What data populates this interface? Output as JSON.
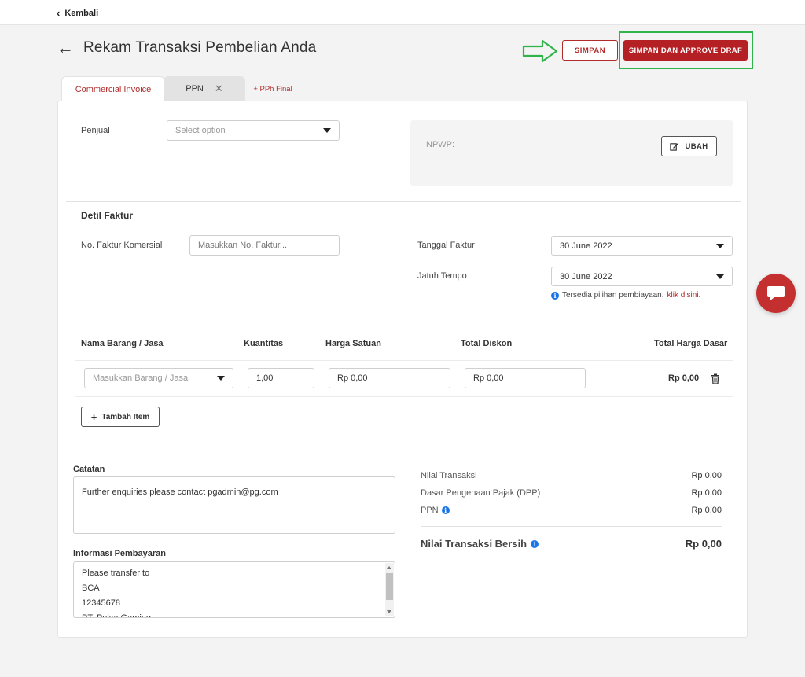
{
  "topbar": {
    "back_label": "Kembali"
  },
  "header": {
    "title": "Rekam Transaksi Pembelian Anda",
    "save_label": "SIMPAN",
    "save_approve_label": "SIMPAN DAN APPROVE DRAF"
  },
  "tabs": [
    {
      "label": "Commercial Invoice",
      "active": true
    },
    {
      "label": "PPN",
      "closable": true
    },
    {
      "label": "+ PPh Final"
    }
  ],
  "seller": {
    "label": "Penjual",
    "placeholder": "Select option",
    "npwp_label": "NPWP:",
    "edit_label": "UBAH"
  },
  "invoice_detail": {
    "section_title": "Detil Faktur",
    "invoice_no_label": "No. Faktur Komersial",
    "invoice_no_placeholder": "Masukkan No. Faktur...",
    "invoice_date_label": "Tanggal Faktur",
    "invoice_date_value": "30 June 2022",
    "due_label": "Jatuh Tempo",
    "due_value": "30 June 2022",
    "financing_note": "Tersedia pilihan pembiayaan,",
    "financing_link": "klik disini."
  },
  "items": {
    "columns": [
      "Nama Barang / Jasa",
      "Kuantitas",
      "Harga Satuan",
      "Total Diskon",
      "Total Harga Dasar"
    ],
    "rows": [
      {
        "item_placeholder": "Masukkan Barang / Jasa",
        "quantity": "1,00",
        "unit_price": "Rp 0,00",
        "discount": "Rp 0,00",
        "total": "Rp 0,00"
      }
    ],
    "add_label": "Tambah Item"
  },
  "notes": {
    "label": "Catatan",
    "value": "Further enquiries please contact pgadmin@pg.com"
  },
  "payment_info": {
    "label": "Informasi Pembayaran",
    "lines": [
      "Please transfer to",
      "BCA",
      "12345678",
      "PT. Pulsa Gaming"
    ]
  },
  "summary": {
    "rows": [
      {
        "label": "Nilai Transaksi",
        "value": "Rp 0,00"
      },
      {
        "label": "Dasar Pengenaan Pajak (DPP)",
        "value": "Rp 0,00"
      },
      {
        "label": "PPN",
        "value": "Rp 0,00"
      }
    ],
    "net_label": "Nilai Transaksi Bersih",
    "net_value": "Rp 0,00"
  },
  "colors": {
    "brand_red": "#b52025",
    "highlight_green": "#2fb34a",
    "info_blue": "#1a73e8"
  }
}
